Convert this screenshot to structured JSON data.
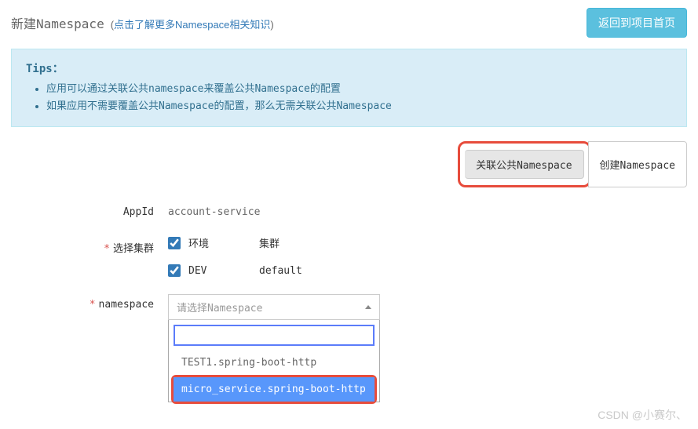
{
  "header": {
    "title": "新建Namespace",
    "subtitle_text": "点击了解更多Namespace相关知识",
    "return_btn": "返回到项目首页"
  },
  "tips": {
    "label": "Tips：",
    "items": [
      "应用可以通过关联公共namespace来覆盖公共Namespace的配置",
      "如果应用不需要覆盖公共Namespace的配置，那么无需关联公共Namespace"
    ]
  },
  "tabs": {
    "link_public": "关联公共Namespace",
    "create": "创建Namespace"
  },
  "form": {
    "appid_label": "AppId",
    "appid_value": "account-service",
    "cluster_label": "选择集群",
    "cluster_header_env": "环境",
    "cluster_header_cluster": "集群",
    "cluster_row_env": "DEV",
    "cluster_row_cluster": "default",
    "namespace_label": "namespace",
    "namespace_placeholder": "请选择Namespace",
    "options": [
      "TEST1.spring-boot-http",
      "micro_service.spring-boot-http"
    ]
  },
  "watermark": "CSDN @小赛尔、"
}
